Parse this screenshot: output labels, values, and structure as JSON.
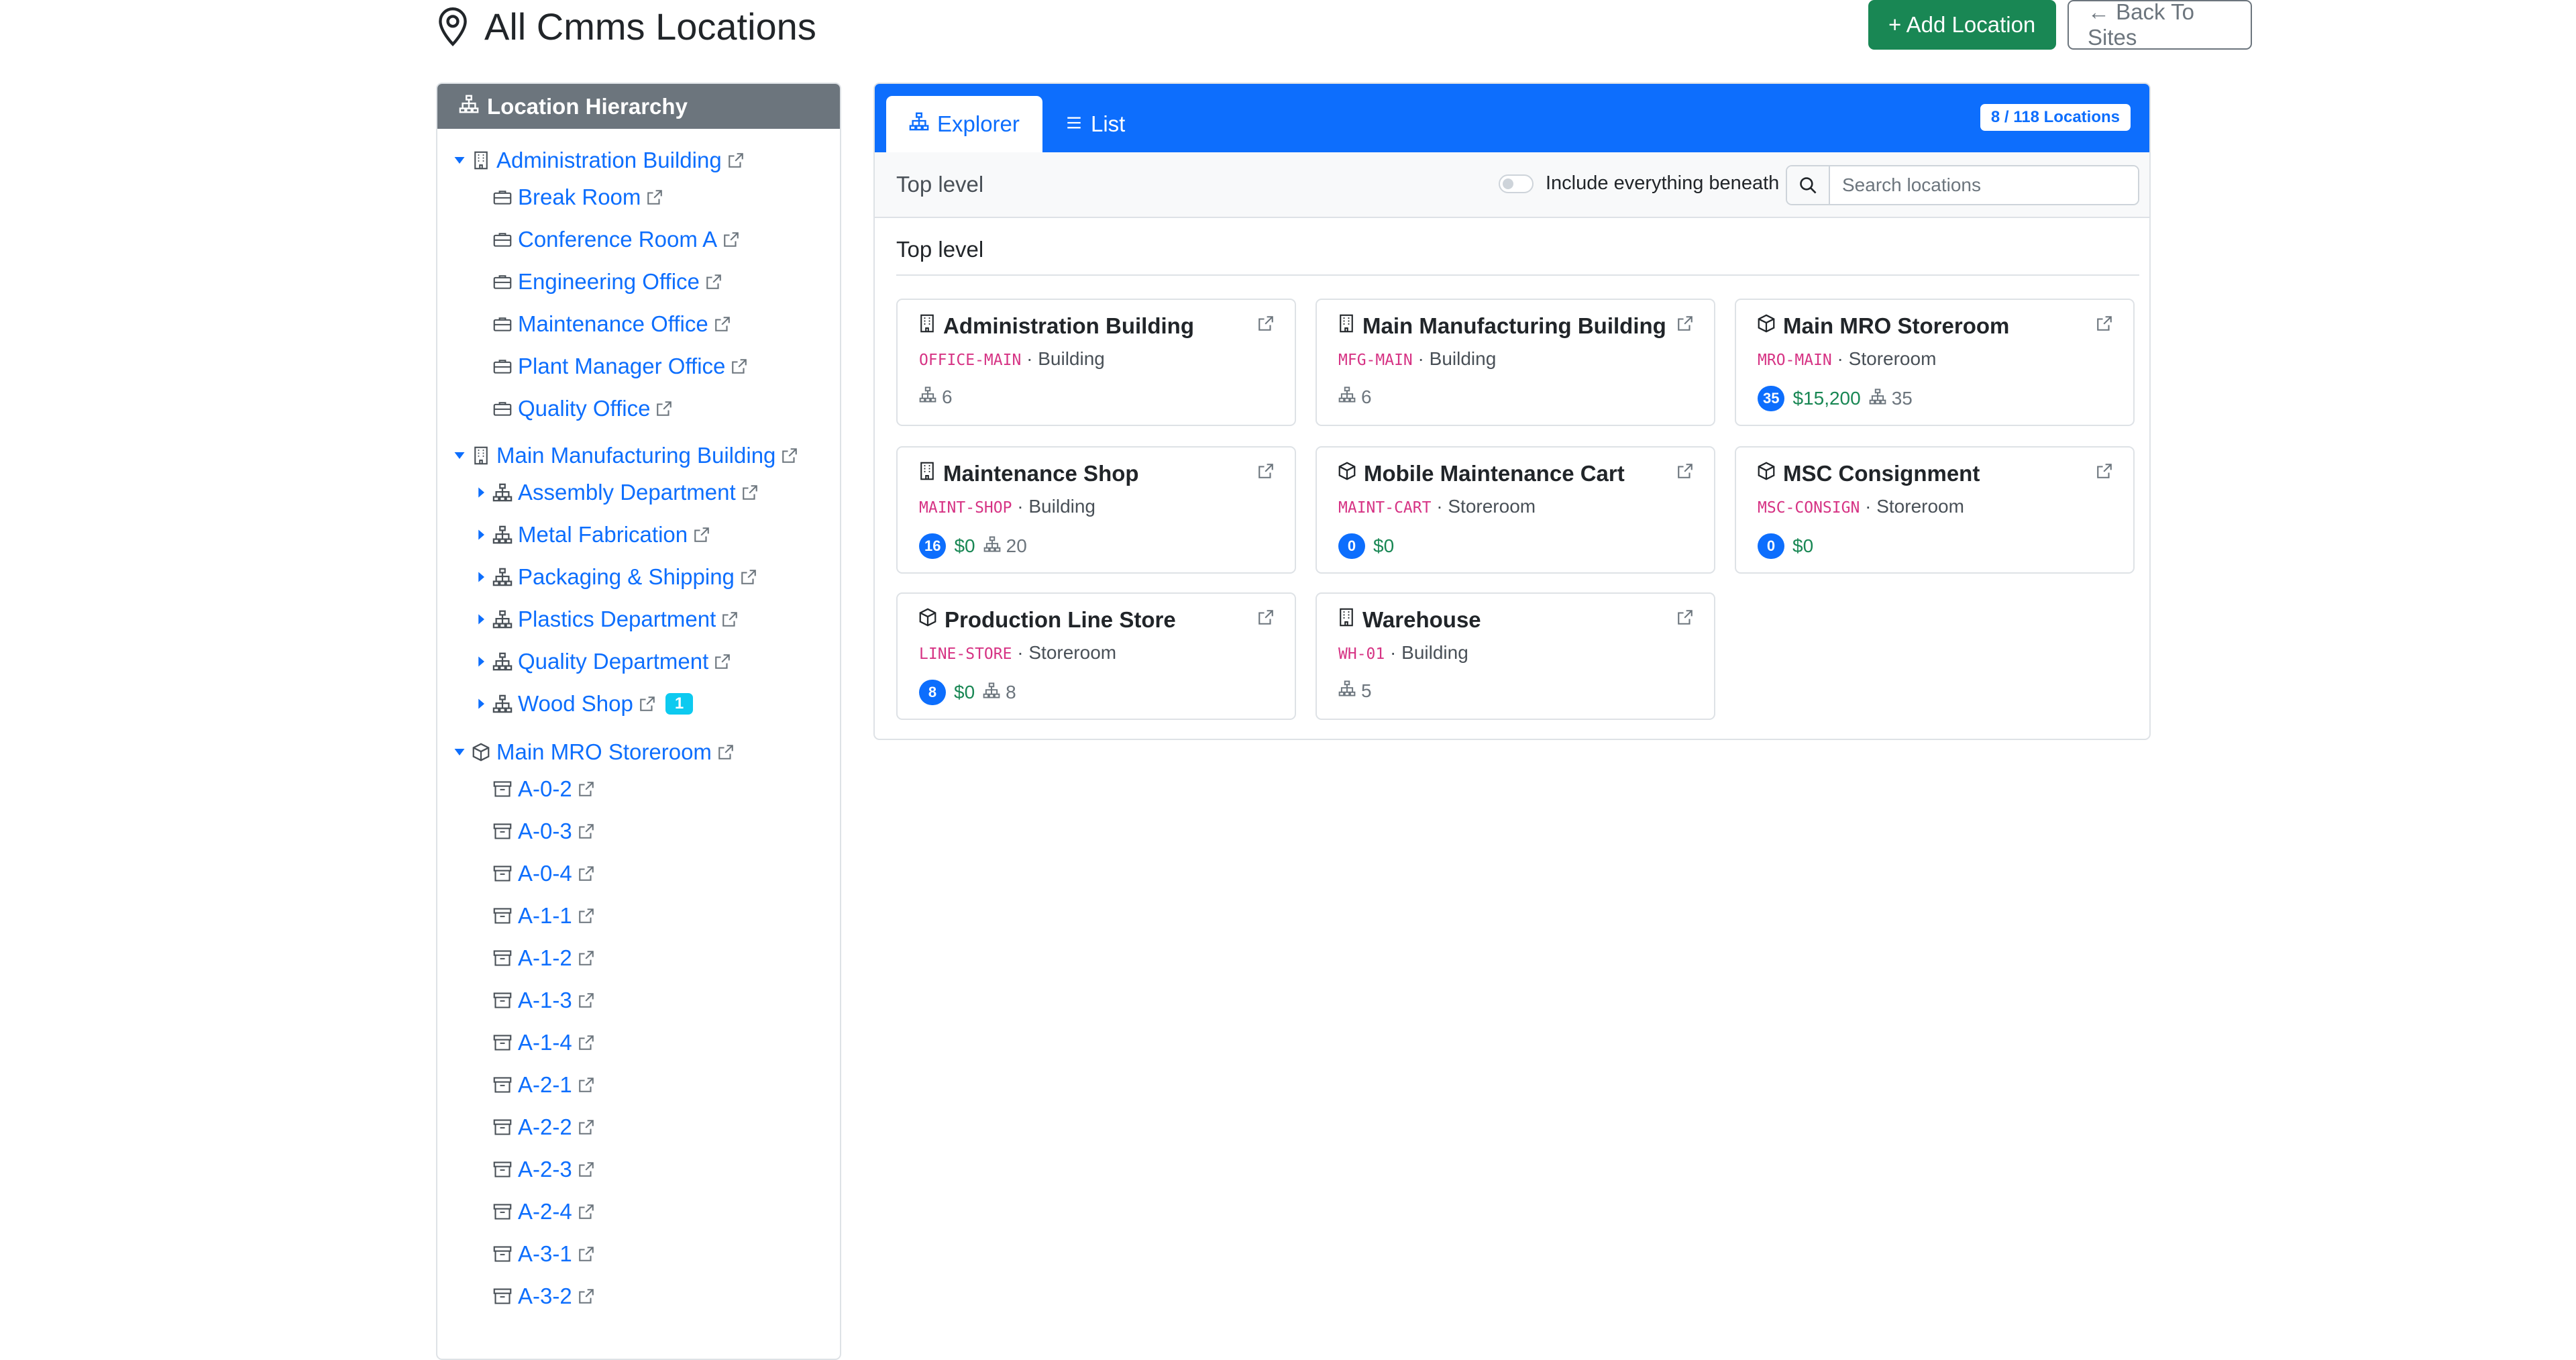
{
  "header": {
    "title": "All Cmms Locations",
    "add_button": "+ Add Location",
    "back_button": "← Back To Sites"
  },
  "sidebar": {
    "title": "Location Hierarchy",
    "items": [
      {
        "label": "Administration Building",
        "depth": 0,
        "caret": "open",
        "icon": "building-icon"
      },
      {
        "label": "Break Room",
        "depth": 1,
        "caret": "none",
        "icon": "briefcase-icon"
      },
      {
        "label": "Conference Room A",
        "depth": 1,
        "caret": "none",
        "icon": "briefcase-icon"
      },
      {
        "label": "Engineering Office",
        "depth": 1,
        "caret": "none",
        "icon": "briefcase-icon"
      },
      {
        "label": "Maintenance Office",
        "depth": 1,
        "caret": "none",
        "icon": "briefcase-icon"
      },
      {
        "label": "Plant Manager Office",
        "depth": 1,
        "caret": "none",
        "icon": "briefcase-icon"
      },
      {
        "label": "Quality Office",
        "depth": 1,
        "caret": "none",
        "icon": "briefcase-icon"
      },
      {
        "label": "Main Manufacturing Building",
        "depth": 0,
        "caret": "open",
        "icon": "building-icon"
      },
      {
        "label": "Assembly Department",
        "depth": 1,
        "caret": "closed",
        "icon": "hierarchy-icon"
      },
      {
        "label": "Metal Fabrication",
        "depth": 1,
        "caret": "closed",
        "icon": "hierarchy-icon"
      },
      {
        "label": "Packaging & Shipping",
        "depth": 1,
        "caret": "closed",
        "icon": "hierarchy-icon"
      },
      {
        "label": "Plastics Department",
        "depth": 1,
        "caret": "closed",
        "icon": "hierarchy-icon"
      },
      {
        "label": "Quality Department",
        "depth": 1,
        "caret": "closed",
        "icon": "hierarchy-icon"
      },
      {
        "label": "Wood Shop",
        "depth": 1,
        "caret": "closed",
        "icon": "hierarchy-icon",
        "badge": "1"
      },
      {
        "label": "Main MRO Storeroom",
        "depth": 0,
        "caret": "open",
        "icon": "box-icon"
      },
      {
        "label": "A-0-2",
        "depth": 1,
        "caret": "none",
        "icon": "archive-icon"
      },
      {
        "label": "A-0-3",
        "depth": 1,
        "caret": "none",
        "icon": "archive-icon"
      },
      {
        "label": "A-0-4",
        "depth": 1,
        "caret": "none",
        "icon": "archive-icon"
      },
      {
        "label": "A-1-1",
        "depth": 1,
        "caret": "none",
        "icon": "archive-icon"
      },
      {
        "label": "A-1-2",
        "depth": 1,
        "caret": "none",
        "icon": "archive-icon"
      },
      {
        "label": "A-1-3",
        "depth": 1,
        "caret": "none",
        "icon": "archive-icon"
      },
      {
        "label": "A-1-4",
        "depth": 1,
        "caret": "none",
        "icon": "archive-icon"
      },
      {
        "label": "A-2-1",
        "depth": 1,
        "caret": "none",
        "icon": "archive-icon"
      },
      {
        "label": "A-2-2",
        "depth": 1,
        "caret": "none",
        "icon": "archive-icon"
      },
      {
        "label": "A-2-3",
        "depth": 1,
        "caret": "none",
        "icon": "archive-icon"
      },
      {
        "label": "A-2-4",
        "depth": 1,
        "caret": "none",
        "icon": "archive-icon"
      },
      {
        "label": "A-3-1",
        "depth": 1,
        "caret": "none",
        "icon": "archive-icon"
      },
      {
        "label": "A-3-2",
        "depth": 1,
        "caret": "none",
        "icon": "archive-icon"
      }
    ]
  },
  "main": {
    "tabs": [
      {
        "label": "Explorer",
        "active": true,
        "icon": "hierarchy-icon"
      },
      {
        "label": "List",
        "active": false,
        "icon": "list-icon"
      }
    ],
    "count_badge": "8 / 118 Locations",
    "breadcrumb": "Top level",
    "toggle_label": "Include everything beneath",
    "toggle_on": false,
    "search_placeholder": "Search locations",
    "section_title": "Top level",
    "cards": [
      {
        "name": "Administration Building",
        "code": "OFFICE-MAIN",
        "sep": " · ",
        "type": "Building",
        "icon": "building-icon",
        "item_count": "",
        "value": "",
        "children": "6"
      },
      {
        "name": "Main Manufacturing Building",
        "code": "MFG-MAIN",
        "sep": " · ",
        "type": "Building",
        "icon": "building-icon",
        "item_count": "",
        "value": "",
        "children": "6"
      },
      {
        "name": "Main MRO Storeroom",
        "code": "MRO-MAIN",
        "sep": " · ",
        "type": "Storeroom",
        "icon": "box-icon",
        "item_count": "35",
        "value": "$15,200",
        "children": "35"
      },
      {
        "name": "Maintenance Shop",
        "code": "MAINT-SHOP",
        "sep": " · ",
        "type": "Building",
        "icon": "building-icon",
        "item_count": "16",
        "value": "$0",
        "children": "20"
      },
      {
        "name": "Mobile Maintenance Cart",
        "code": "MAINT-CART",
        "sep": " · ",
        "type": "Storeroom",
        "icon": "box-icon",
        "item_count": "0",
        "value": "$0",
        "children": ""
      },
      {
        "name": "MSC Consignment",
        "code": "MSC-CONSIGN",
        "sep": " · ",
        "type": "Storeroom",
        "icon": "box-icon",
        "item_count": "0",
        "value": "$0",
        "children": ""
      },
      {
        "name": "Production Line Store",
        "code": "LINE-STORE",
        "sep": " · ",
        "type": "Storeroom",
        "icon": "box-icon",
        "item_count": "8",
        "value": "$0",
        "children": "8"
      },
      {
        "name": "Warehouse",
        "code": "WH-01",
        "sep": " · ",
        "type": "Building",
        "icon": "building-icon",
        "item_count": "",
        "value": "",
        "children": "5"
      }
    ]
  },
  "colors": {
    "primary": "#0d6efd",
    "success": "#198754",
    "secondary": "#6c757d",
    "info": "#0dcaf0",
    "code": "#d63384"
  }
}
